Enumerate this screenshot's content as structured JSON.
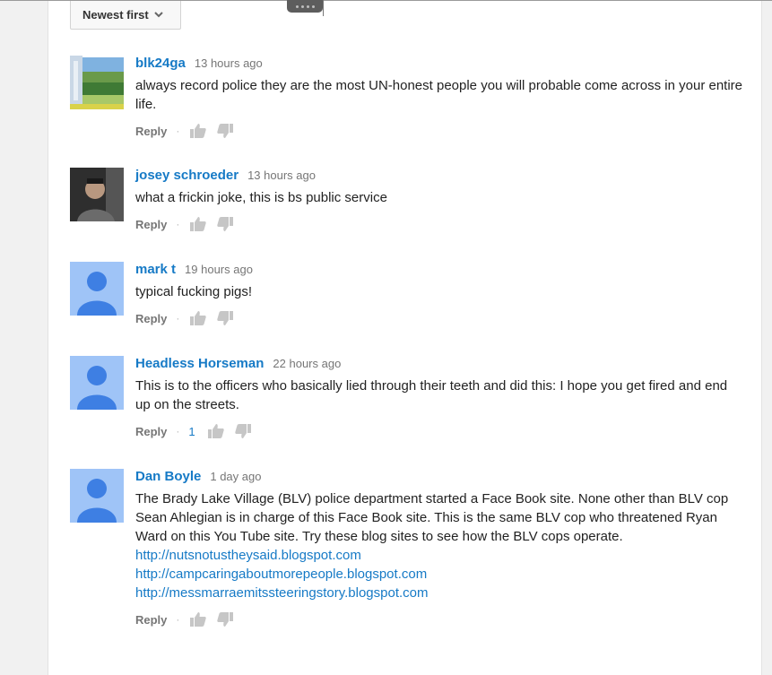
{
  "sort": {
    "label": "Newest first"
  },
  "actions": {
    "reply_label": "Reply",
    "separator": "·"
  },
  "comments": [
    {
      "author": "blk24ga",
      "time": "13 hours ago",
      "text": "always record police they are the most UN-honest people you will probable come across in your entire life.",
      "avatar": "landscape-photo",
      "likes": "",
      "links": []
    },
    {
      "author": "josey schroeder",
      "time": "13 hours ago",
      "text": "what a frickin joke, this is bs public service",
      "avatar": "user-photo",
      "likes": "",
      "links": []
    },
    {
      "author": "mark t",
      "time": "19 hours ago",
      "text": "typical fucking pigs!",
      "avatar": "default-user-icon",
      "likes": "",
      "links": []
    },
    {
      "author": "Headless Horseman",
      "time": "22 hours ago",
      "text": "This is to the officers who basically lied through their teeth and did this: I hope you get fired and end up on the streets.",
      "avatar": "default-user-icon",
      "likes": "1",
      "links": []
    },
    {
      "author": "Dan Boyle",
      "time": "1 day ago",
      "text": "The Brady Lake Village (BLV) police department started a Face Book site. None other than BLV cop Sean Ahlegian is in charge of this Face Book site. This is the same BLV cop who threatened Ryan Ward on this You Tube site. Try these blog sites to see how the BLV cops operate.",
      "avatar": "default-user-icon",
      "likes": "",
      "links": [
        "http://nutsnotustheysaid.blogspot.com",
        "http://campcaringaboutmorepeople.blogspot.com",
        "http://messmarraemitssteeringstory.blogspot.com"
      ]
    }
  ],
  "colors": {
    "link_blue": "#167ac6",
    "muted_gray": "#767676",
    "avatar_blue": "#9fc4f7",
    "avatar_figure": "#3e7fe3"
  }
}
